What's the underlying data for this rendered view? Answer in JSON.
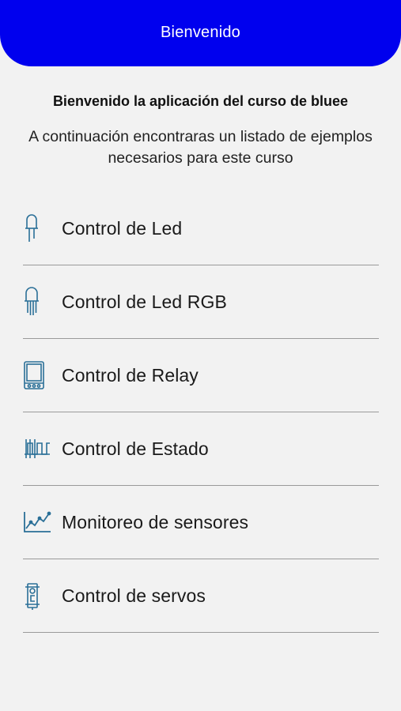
{
  "appbar": {
    "title": "Bienvenido",
    "color": "#0000ee"
  },
  "intro": {
    "heading": "Bienvenido la aplicación del curso de bluee",
    "subtitle": "A continuación encontraras un listado de ejemplos necesarios para este curso"
  },
  "menu": {
    "icon_color": "#2a6f97",
    "items": [
      {
        "label": "Control de Led",
        "icon": "led-icon"
      },
      {
        "label": "Control de Led RGB",
        "icon": "rgb-led-icon"
      },
      {
        "label": "Control de Relay",
        "icon": "relay-icon"
      },
      {
        "label": "Control de Estado",
        "icon": "state-signal-icon"
      },
      {
        "label": "Monitoreo de sensores",
        "icon": "sensor-chart-icon"
      },
      {
        "label": "Control de servos",
        "icon": "servo-icon"
      }
    ]
  }
}
